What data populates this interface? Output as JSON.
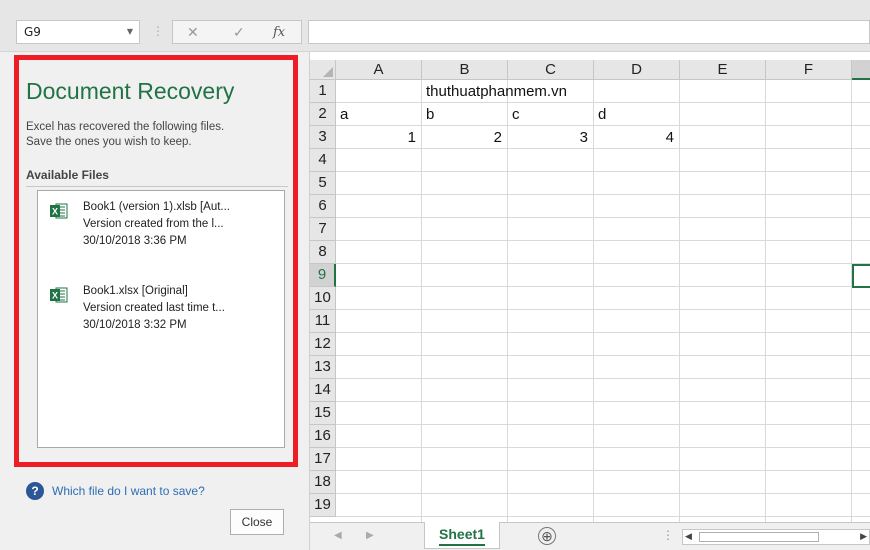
{
  "formula_bar": {
    "name_box": "G9",
    "cancel_icon": "✕",
    "enter_icon": "✓",
    "fx_label": "fx",
    "formula": ""
  },
  "recovery": {
    "title": "Document Recovery",
    "desc_line1": "Excel has recovered the following files.",
    "desc_line2": "Save the ones you wish to keep.",
    "available_label": "Available Files",
    "files": [
      {
        "name": "Book1 (version 1).xlsb  [Aut...",
        "detail": "Version created from the l...",
        "date": "30/10/2018 3:36 PM"
      },
      {
        "name": "Book1.xlsx  [Original]",
        "detail": "Version created last time t...",
        "date": "30/10/2018 3:32 PM"
      }
    ],
    "help_link": "Which file do I want to save?",
    "close_label": "Close",
    "highlight_color": "#ee1c24",
    "accent_color": "#217346"
  },
  "sheet": {
    "columns": [
      "A",
      "B",
      "C",
      "D",
      "E",
      "F"
    ],
    "rows": [
      "1",
      "2",
      "3",
      "4",
      "5",
      "6",
      "7",
      "8",
      "9",
      "10",
      "11",
      "12",
      "13",
      "14",
      "15",
      "16",
      "17",
      "18",
      "19"
    ],
    "selected_row": "9",
    "cells": {
      "B1": "thuthuatphanmem.vn",
      "A2": "a",
      "B2": "b",
      "C2": "c",
      "D2": "d",
      "A3": "1",
      "B3": "2",
      "C3": "3",
      "D3": "4"
    }
  },
  "tabs": {
    "sheet_name": "Sheet1",
    "add_icon": "⊕"
  }
}
